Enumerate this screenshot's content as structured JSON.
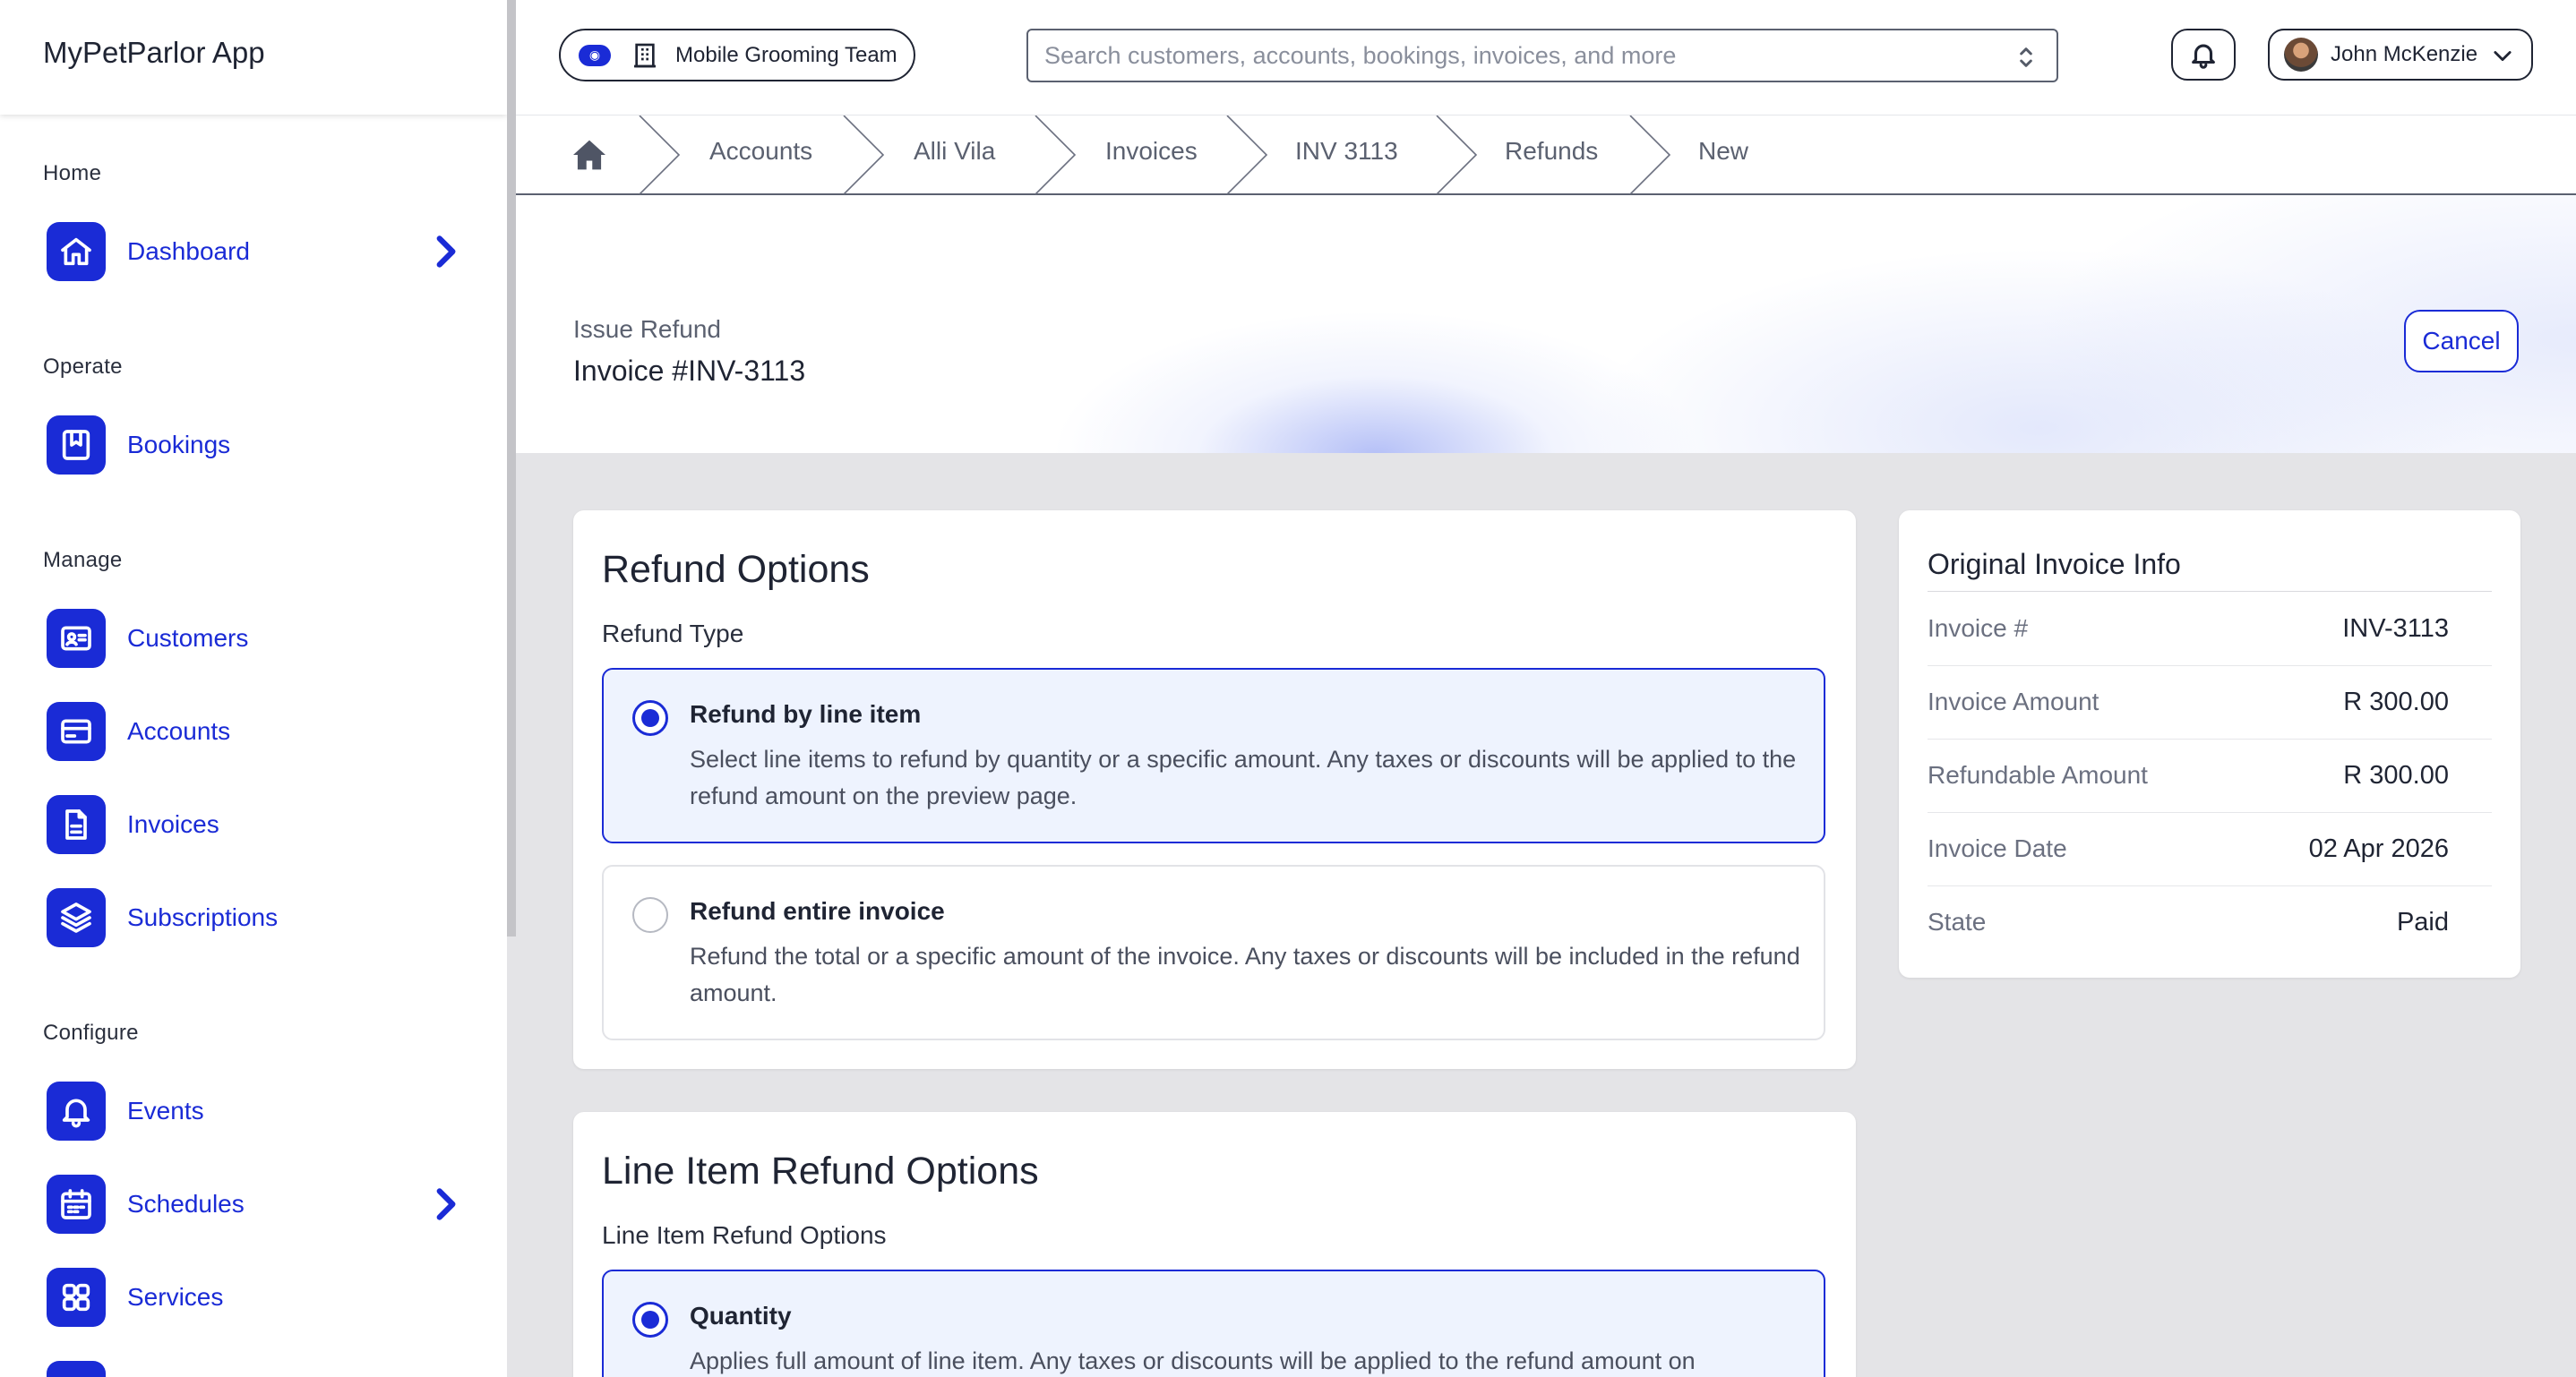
{
  "app": {
    "title": "MyPetParlor App"
  },
  "sidebar": {
    "sections": [
      {
        "label": "Home"
      },
      {
        "label": "Operate"
      },
      {
        "label": "Manage"
      },
      {
        "label": "Configure"
      }
    ],
    "items": [
      {
        "label": "Dashboard",
        "icon": "home-icon"
      },
      {
        "label": "Bookings",
        "icon": "bookmark-icon"
      },
      {
        "label": "Customers",
        "icon": "id-card-icon"
      },
      {
        "label": "Accounts",
        "icon": "credit-card-icon"
      },
      {
        "label": "Invoices",
        "icon": "document-icon"
      },
      {
        "label": "Subscriptions",
        "icon": "layers-icon"
      },
      {
        "label": "Events",
        "icon": "bell-icon"
      },
      {
        "label": "Schedules",
        "icon": "calendar-icon"
      },
      {
        "label": "Services",
        "icon": "grid-icon"
      }
    ]
  },
  "topbar": {
    "team_label": "Mobile Grooming Team",
    "search_placeholder": "Search customers, accounts, bookings, invoices, and more",
    "user_name": "John McKenzie"
  },
  "breadcrumb": [
    "Accounts",
    "Alli Vila",
    "Invoices",
    "INV 3113",
    "Refunds",
    "New"
  ],
  "header": {
    "eyebrow": "Issue Refund",
    "title": "Invoice #INV-3113",
    "cancel_label": "Cancel"
  },
  "refund_options": {
    "title": "Refund Options",
    "field_label": "Refund Type",
    "options": [
      {
        "title": "Refund by line item",
        "description": "Select line items to refund by quantity or a specific amount. Any taxes or discounts will be applied to the refund amount on the preview page.",
        "selected": true
      },
      {
        "title": "Refund entire invoice",
        "description": "Refund the total or a specific amount of the invoice. Any taxes or discounts will be included in the refund amount.",
        "selected": false
      }
    ]
  },
  "line_item_options": {
    "title": "Line Item Refund Options",
    "field_label": "Line Item Refund Options",
    "options": [
      {
        "title": "Quantity",
        "description": "Applies full amount of line item. Any taxes or discounts will be applied to the refund amount on",
        "selected": true
      }
    ]
  },
  "invoice_info": {
    "title": "Original Invoice Info",
    "rows": [
      {
        "key": "Invoice #",
        "value": "INV-3113"
      },
      {
        "key": "Invoice Amount",
        "value": "R 300.00"
      },
      {
        "key": "Refundable Amount",
        "value": "R 300.00"
      },
      {
        "key": "Invoice Date",
        "value": "02 Apr 2026"
      },
      {
        "key": "State",
        "value": "Paid"
      }
    ]
  },
  "colors": {
    "accent": "#1a2bd6",
    "selected_bg": "#eef3fe",
    "page_bg": "#e4e4e7"
  }
}
